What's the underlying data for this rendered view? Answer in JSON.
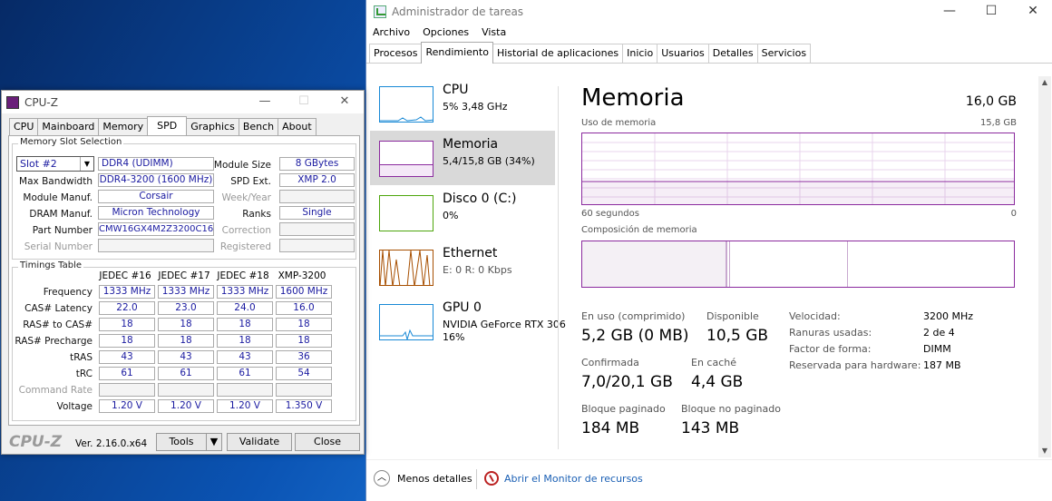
{
  "taskmanager": {
    "title": "Administrador de tareas",
    "menu": [
      "Archivo",
      "Opciones",
      "Vista"
    ],
    "tabs": [
      "Procesos",
      "Rendimiento",
      "Historial de aplicaciones",
      "Inicio",
      "Usuarios",
      "Detalles",
      "Servicios"
    ],
    "active_tab": "Rendimiento",
    "sidebar": [
      {
        "name": "CPU",
        "sub": "5% 3,48 GHz",
        "color": "#1889d6"
      },
      {
        "name": "Memoria",
        "sub": "5,4/15,8 GB (34%)",
        "color": "#8b2a9e"
      },
      {
        "name": "Disco 0 (C:)",
        "sub": "0%",
        "color": "#4da60c"
      },
      {
        "name": "Ethernet",
        "sub": "E: 0 R: 0 Kbps",
        "color": "#a74f01"
      },
      {
        "name": "GPU 0",
        "sub": "NVIDIA GeForce RTX 306",
        "sub2": "16%",
        "color": "#1889d6"
      }
    ],
    "memory": {
      "title": "Memoria",
      "total": "16,0 GB",
      "usage_label": "Uso de memoria",
      "usage_max": "15,8 GB",
      "time_left": "60 segundos",
      "time_right": "0",
      "composition_label": "Composición de memoria",
      "in_use_label": "En uso (comprimido)",
      "in_use_value": "5,2 GB (0 MB)",
      "available_label": "Disponible",
      "available_value": "10,5 GB",
      "committed_label": "Confirmada",
      "committed_value": "7,0/20,1 GB",
      "cached_label": "En caché",
      "cached_value": "4,4 GB",
      "paged_label": "Bloque paginado",
      "paged_value": "184 MB",
      "nonpaged_label": "Bloque no paginado",
      "nonpaged_value": "143 MB",
      "props": [
        {
          "k": "Velocidad:",
          "v": "3200 MHz"
        },
        {
          "k": "Ranuras usadas:",
          "v": "2 de 4"
        },
        {
          "k": "Factor de forma:",
          "v": "DIMM"
        },
        {
          "k": "Reservada para hardware:",
          "v": "187 MB"
        }
      ],
      "usage_fraction": 0.34
    },
    "footer": {
      "less_details": "Menos detalles",
      "monitor_link": "Abrir el Monitor de recursos"
    }
  },
  "cpuz": {
    "title": "CPU-Z",
    "tabs": [
      "CPU",
      "Mainboard",
      "Memory",
      "SPD",
      "Graphics",
      "Bench",
      "About"
    ],
    "active_tab": "SPD",
    "slot_group": "Memory Slot Selection",
    "slot": "Slot #2",
    "type": "DDR4 (UDIMM)",
    "module_size_label": "Module Size",
    "module_size": "8 GBytes",
    "max_bw_label": "Max Bandwidth",
    "max_bw": "DDR4-3200 (1600 MHz)",
    "spd_ext_label": "SPD Ext.",
    "spd_ext": "XMP 2.0",
    "manuf_label": "Module Manuf.",
    "manuf": "Corsair",
    "week_label": "Week/Year",
    "dram_label": "DRAM Manuf.",
    "dram": "Micron Technology",
    "ranks_label": "Ranks",
    "ranks": "Single",
    "part_label": "Part Number",
    "part": "CMW16GX4M2Z3200C16",
    "correction_label": "Correction",
    "serial_label": "Serial Number",
    "registered_label": "Registered",
    "timings_group": "Timings Table",
    "timing_headers": [
      "JEDEC #16",
      "JEDEC #17",
      "JEDEC #18",
      "XMP-3200"
    ],
    "timings": [
      {
        "label": "Frequency",
        "vals": [
          "1333 MHz",
          "1333 MHz",
          "1333 MHz",
          "1600 MHz"
        ]
      },
      {
        "label": "CAS# Latency",
        "vals": [
          "22.0",
          "23.0",
          "24.0",
          "16.0"
        ]
      },
      {
        "label": "RAS# to CAS#",
        "vals": [
          "18",
          "18",
          "18",
          "18"
        ]
      },
      {
        "label": "RAS# Precharge",
        "vals": [
          "18",
          "18",
          "18",
          "18"
        ]
      },
      {
        "label": "tRAS",
        "vals": [
          "43",
          "43",
          "43",
          "36"
        ]
      },
      {
        "label": "tRC",
        "vals": [
          "61",
          "61",
          "61",
          "54"
        ]
      },
      {
        "label": "Command Rate",
        "vals": [
          "",
          "",
          "",
          ""
        ],
        "dim": true
      },
      {
        "label": "Voltage",
        "vals": [
          "1.20 V",
          "1.20 V",
          "1.20 V",
          "1.350 V"
        ]
      }
    ],
    "logo": "CPU-Z",
    "version": "Ver. 2.16.0.x64",
    "tools": "Tools",
    "validate": "Validate",
    "close": "Close"
  }
}
